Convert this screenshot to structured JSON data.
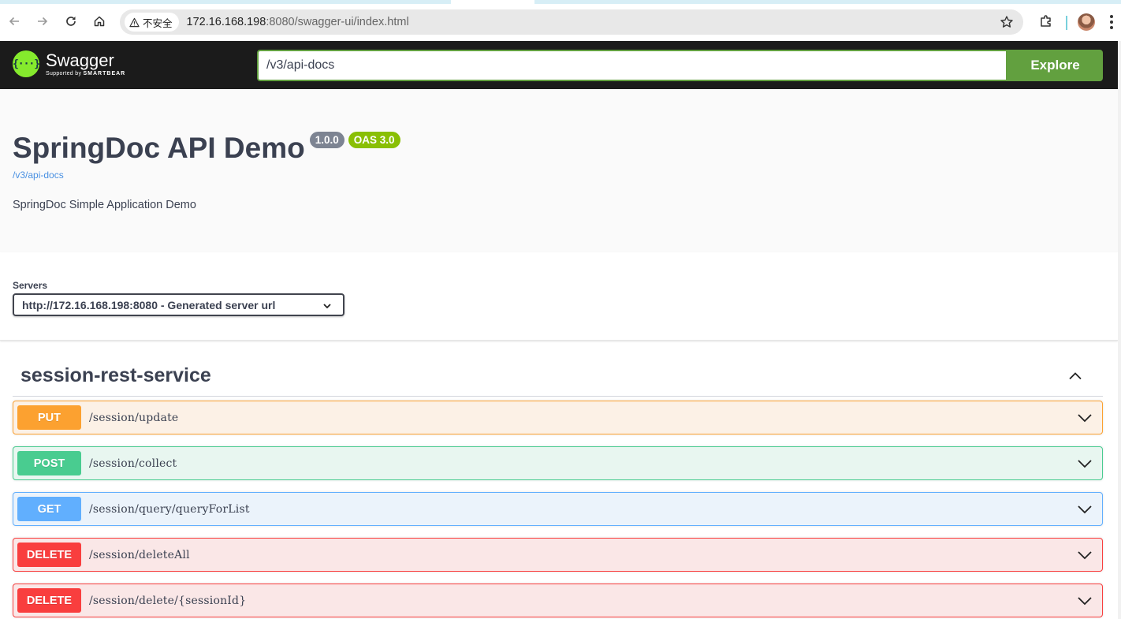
{
  "browser": {
    "security_label": "不安全",
    "url_host": "172.16.168.198",
    "url_rest": ":8080/swagger-ui/index.html"
  },
  "topbar": {
    "logo_title": "Swagger",
    "logo_supported": "Supported by",
    "logo_smartbear": "SMARTBEAR",
    "spec_url_value": "/v3/api-docs",
    "explore_label": "Explore"
  },
  "info": {
    "title": "SpringDoc API Demo",
    "version_badge": "1.0.0",
    "oas_badge": "OAS 3.0",
    "spec_link": "/v3/api-docs",
    "description": "SpringDoc Simple Application Demo"
  },
  "servers": {
    "label": "Servers",
    "selected": "http://172.16.168.198:8080 - Generated server url"
  },
  "tag": {
    "name": "session-rest-service"
  },
  "operations": [
    {
      "method": "PUT",
      "path": "/session/update"
    },
    {
      "method": "POST",
      "path": "/session/collect"
    },
    {
      "method": "GET",
      "path": "/session/query/queryForList"
    },
    {
      "method": "DELETE",
      "path": "/session/deleteAll"
    },
    {
      "method": "DELETE",
      "path": "/session/delete/{sessionId}"
    }
  ],
  "colors": {
    "put": "#fca130",
    "post": "#49cc90",
    "get": "#61affe",
    "delete": "#f93e3e",
    "explore": "#62a03f",
    "oas": "#89bf04"
  }
}
